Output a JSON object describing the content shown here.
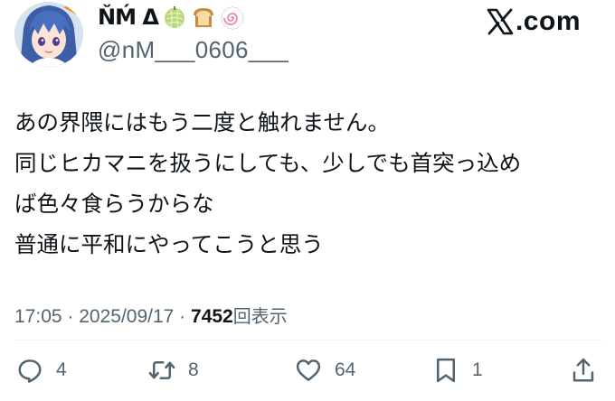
{
  "author": {
    "display_name": "ŇḾ Δ",
    "name_emojis": [
      "melon-emoji",
      "bread-emoji",
      "narutomaki-emoji"
    ],
    "handle": "@nM___0606___"
  },
  "watermark": {
    "domain": ".com"
  },
  "tweet": {
    "lines": [
      "あの界隈にはもう二度と触れません。",
      "同じヒカマニを扱うにしても、少しでも首突っ込め",
      "ば色々食らうからな",
      "普通に平和にやってこうと思う"
    ],
    "time": "17:05",
    "separator": " · ",
    "date": "2025/09/17",
    "views_count": "7452",
    "views_label": "回表示"
  },
  "actions": {
    "reply": {
      "icon": "reply-icon",
      "count": "4"
    },
    "retweet": {
      "icon": "retweet-icon",
      "count": "8"
    },
    "like": {
      "icon": "heart-icon",
      "count": "64"
    },
    "bookmark": {
      "icon": "bookmark-icon",
      "count": "1"
    },
    "share": {
      "icon": "share-icon"
    }
  },
  "colors": {
    "text": "#0f1419",
    "secondary": "#536471",
    "divider": "#eff3f4"
  }
}
